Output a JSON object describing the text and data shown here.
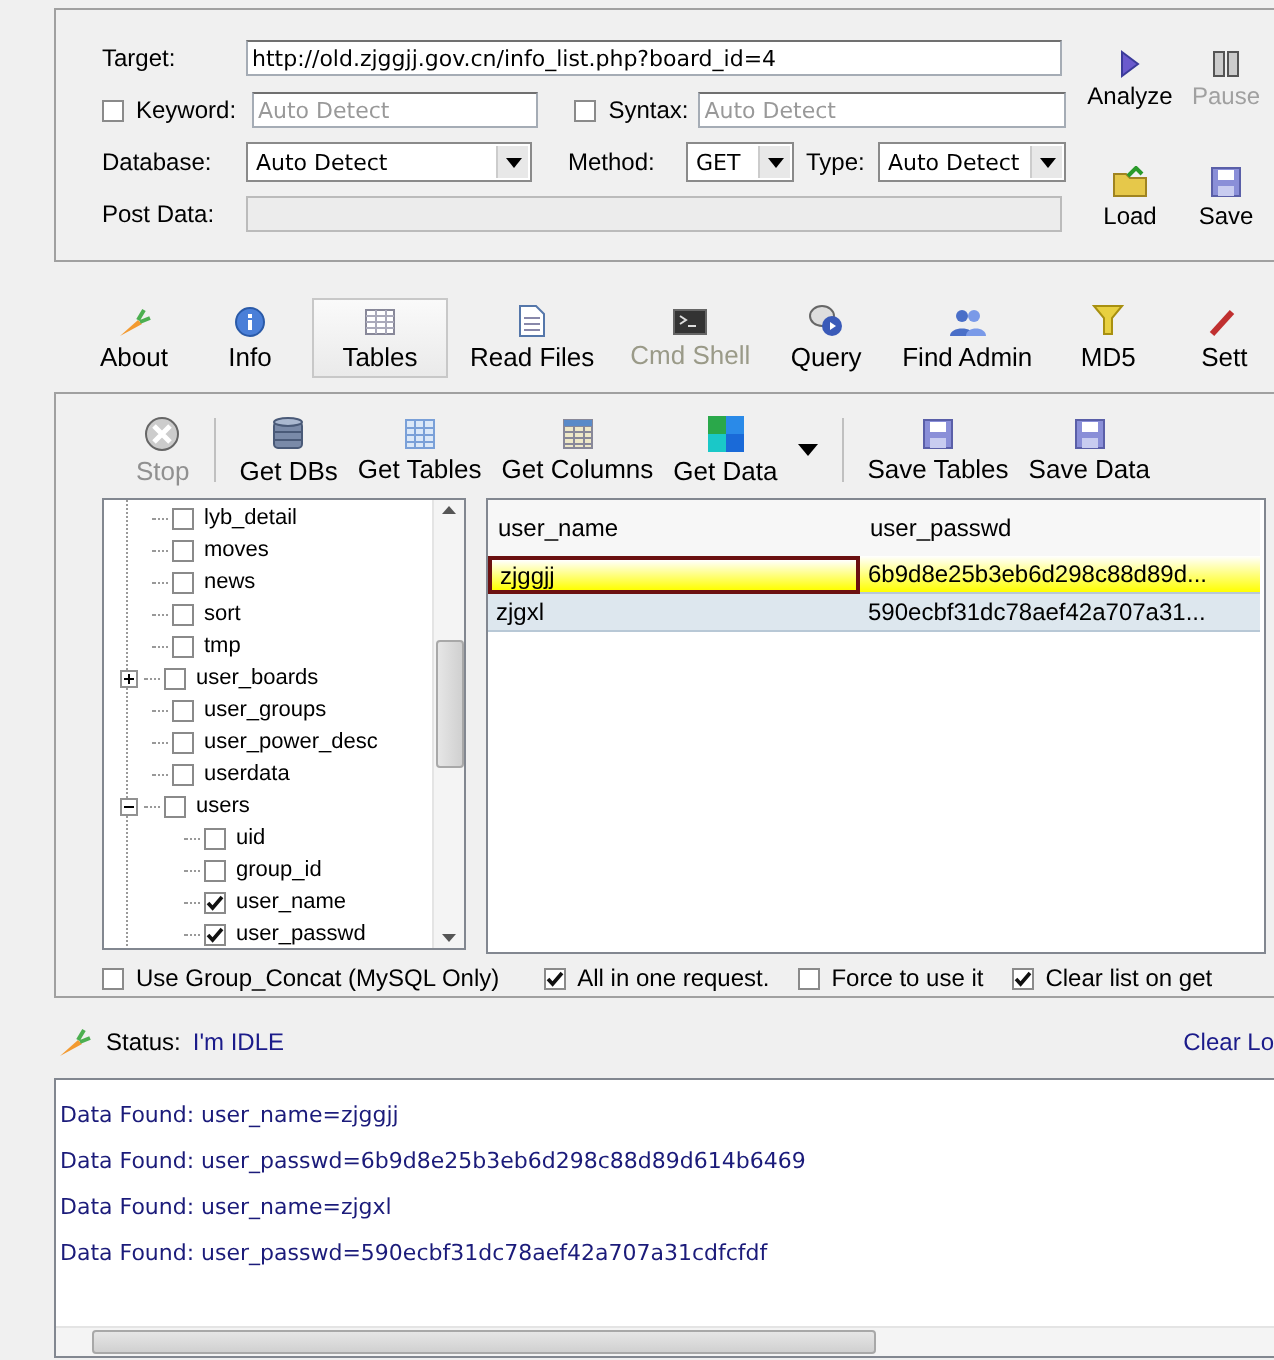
{
  "target": {
    "label": "Target:",
    "value": "http://old.zjggjj.gov.cn/info_list.php?board_id=4"
  },
  "keyword": {
    "label": "Keyword:",
    "checked": false,
    "placeholder": "Auto Detect"
  },
  "syntax": {
    "label": "Syntax:",
    "checked": false,
    "placeholder": "Auto Detect"
  },
  "database": {
    "label": "Database:",
    "value": "Auto Detect"
  },
  "method": {
    "label": "Method:",
    "value": "GET"
  },
  "type": {
    "label": "Type:",
    "value": "Auto Detect"
  },
  "post_data": {
    "label": "Post Data:"
  },
  "side_buttons": [
    {
      "kind": "analyze",
      "label": "Analyze",
      "disabled": false
    },
    {
      "kind": "pause",
      "label": "Pause",
      "disabled": true
    },
    {
      "kind": "load",
      "label": "Load",
      "disabled": false
    },
    {
      "kind": "save",
      "label": "Save",
      "disabled": false
    }
  ],
  "tabs": [
    {
      "kind": "about",
      "label": "About",
      "selected": false,
      "disabled": false
    },
    {
      "kind": "info",
      "label": "Info",
      "selected": false,
      "disabled": false
    },
    {
      "kind": "tables",
      "label": "Tables",
      "selected": true,
      "disabled": false
    },
    {
      "kind": "files",
      "label": "Read Files",
      "selected": false,
      "disabled": false
    },
    {
      "kind": "shell",
      "label": "Cmd Shell",
      "selected": false,
      "disabled": true
    },
    {
      "kind": "query",
      "label": "Query",
      "selected": false,
      "disabled": false
    },
    {
      "kind": "admin",
      "label": "Find Admin",
      "selected": false,
      "disabled": false
    },
    {
      "kind": "md5",
      "label": "MD5",
      "selected": false,
      "disabled": false
    },
    {
      "kind": "settings",
      "label": "Sett",
      "selected": false,
      "disabled": false
    }
  ],
  "toolbar_groups": [
    [
      {
        "kind": "stop",
        "label": "Stop",
        "disabled": true
      }
    ],
    [
      {
        "kind": "dbs",
        "label": "Get DBs",
        "disabled": false
      },
      {
        "kind": "tables",
        "label": "Get Tables",
        "disabled": false
      },
      {
        "kind": "columns",
        "label": "Get Columns",
        "disabled": false
      },
      {
        "kind": "data",
        "label": "Get Data",
        "disabled": false
      }
    ],
    [
      {
        "kind": "save",
        "label": "Save Tables",
        "disabled": false
      },
      {
        "kind": "save",
        "label": "Save Data",
        "disabled": false
      }
    ]
  ],
  "tree": [
    {
      "label": "lyb_detail",
      "checked": false
    },
    {
      "label": "moves",
      "checked": false
    },
    {
      "label": "news",
      "checked": false
    },
    {
      "label": "sort",
      "checked": false
    },
    {
      "label": "tmp",
      "checked": false
    },
    {
      "label": "user_boards",
      "checked": false,
      "expanded": false
    },
    {
      "label": "user_groups",
      "checked": false
    },
    {
      "label": "user_power_desc",
      "checked": false
    },
    {
      "label": "userdata",
      "checked": false
    },
    {
      "label": "users",
      "checked": false,
      "expanded": true,
      "children": [
        {
          "label": "uid",
          "checked": false
        },
        {
          "label": "group_id",
          "checked": false
        },
        {
          "label": "user_name",
          "checked": true
        },
        {
          "label": "user_passwd",
          "checked": true
        }
      ]
    }
  ],
  "grid": {
    "columns": [
      "user_name",
      "user_passwd"
    ],
    "rows": [
      {
        "selected": true,
        "cells": [
          "zjggjj",
          "6b9d8e25b3eb6d298c88d89d..."
        ]
      },
      {
        "selected": false,
        "cells": [
          "zjgxl",
          "590ecbf31dc78aef42a707a31..."
        ]
      }
    ]
  },
  "options": [
    {
      "label": "Use Group_Concat (MySQL Only)",
      "checked": false
    },
    {
      "label": "All in one request.",
      "checked": true
    },
    {
      "label": "Force to use it",
      "checked": false
    },
    {
      "label": "Clear list on get",
      "checked": true
    }
  ],
  "status": {
    "label": "Status:",
    "value": "I'm IDLE",
    "clear_log": "Clear Lo"
  },
  "log": [
    "Data Found: user_name=zjggjj",
    "Data Found: user_passwd=6b9d8e25b3eb6d298c88d89d614b6469",
    "Data Found: user_name=zjgxl",
    "Data Found: user_passwd=590ecbf31dc78aef42a707a31cdfcfdf"
  ]
}
